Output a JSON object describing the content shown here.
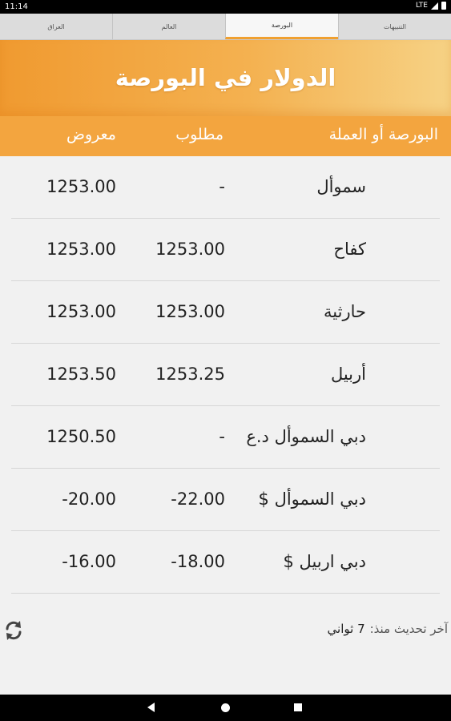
{
  "status_bar": {
    "time": "11:14",
    "network": "LTE"
  },
  "tabs": [
    {
      "label": "التنبيهات",
      "active": false
    },
    {
      "label": "البورصة",
      "active": true
    },
    {
      "label": "العالم",
      "active": false
    },
    {
      "label": "العراق",
      "active": false
    }
  ],
  "banner": {
    "title": "الدولار في البورصة"
  },
  "columns": {
    "exchange": "البورصة أو العملة",
    "bid": "مطلوب",
    "ask": "معروض"
  },
  "rows": [
    {
      "exchange": "سموأل",
      "bid": "-",
      "ask": "1253.00"
    },
    {
      "exchange": "كفاح",
      "bid": "1253.00",
      "ask": "1253.00"
    },
    {
      "exchange": "حارثية",
      "bid": "1253.00",
      "ask": "1253.00"
    },
    {
      "exchange": "أربيل",
      "bid": "1253.25",
      "ask": "1253.50"
    },
    {
      "exchange": "دبي السموأل د.ع",
      "bid": "-",
      "ask": "1250.50"
    },
    {
      "exchange": "دبي السموأل $",
      "bid": "-22.00",
      "ask": "-20.00"
    },
    {
      "exchange": "دبي اربيل $",
      "bid": "-18.00",
      "ask": "-16.00"
    }
  ],
  "footer": {
    "last_update_label": "آخر تحديث منذ:",
    "last_update_value": "7 ثواني",
    "refresh_icon": "refresh-icon"
  },
  "colors": {
    "accent": "#f3a53f",
    "banner_light": "#f6d285",
    "tab_indicator": "#f0a030"
  }
}
